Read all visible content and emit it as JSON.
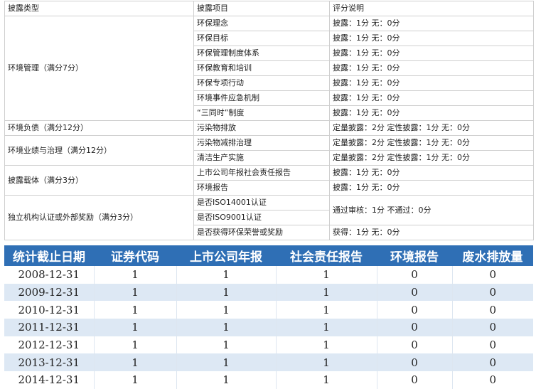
{
  "disclosure_table": {
    "headers": [
      "披露类型",
      "披露项目",
      "评分说明"
    ],
    "groups": [
      {
        "type": "环境管理（满分7分）",
        "items": [
          {
            "item": "环保理念",
            "rule": "披露：1分 无：0分"
          },
          {
            "item": "环保目标",
            "rule": "披露：1分 无：0分"
          },
          {
            "item": "环保管理制度体系",
            "rule": "披露：1分 无：0分"
          },
          {
            "item": "环保教育和培训",
            "rule": "披露：1分 无：0分"
          },
          {
            "item": "环保专项行动",
            "rule": "披露：1分 无：0分"
          },
          {
            "item": "环境事件应急机制",
            "rule": "披露：1分 无：0分"
          },
          {
            "item": "“三同时”制度",
            "rule": "披露：1分 无：0分"
          }
        ]
      },
      {
        "type": "环境负债（满分12分）",
        "items": [
          {
            "item": "污染物排放",
            "rule": "定量披露：2分 定性披露：1分 无：0分"
          }
        ]
      },
      {
        "type": "环境业绩与治理（满分12分）",
        "items": [
          {
            "item": "污染物减排治理",
            "rule": "定量披露：2分 定性披露：1分 无：0分"
          },
          {
            "item": "清洁生产实施",
            "rule": "定量披露：2分 定性披露：1分 无：0分"
          }
        ]
      },
      {
        "type": "披露载体（满分3分）",
        "items": [
          {
            "item": "上市公司年报社会责任报告",
            "rule": "披露：1分 无：0分"
          },
          {
            "item": "环境报告",
            "rule": "披露：1分 无：0分"
          }
        ]
      },
      {
        "type": "独立机构认证或外部奖励（满分3分）",
        "items": [
          {
            "item": "是否ISO14001认证"
          },
          {
            "item": "是否ISO9001认证"
          },
          {
            "item": "是否获得环保荣誉或奖励",
            "rule": "获得：1分 无：0分"
          }
        ],
        "merged_rule": "通过审核：1分 不通过：0分"
      }
    ]
  },
  "data_table": {
    "headers": [
      "统计截止日期",
      "证券代码",
      "上市公司年报",
      "社会责任报告",
      "环境报告",
      "废水排放量"
    ],
    "rows": [
      [
        "2008-12-31",
        "1",
        "1",
        "1",
        "0",
        "0"
      ],
      [
        "2009-12-31",
        "1",
        "1",
        "1",
        "0",
        "0"
      ],
      [
        "2010-12-31",
        "1",
        "1",
        "1",
        "0",
        "0"
      ],
      [
        "2011-12-31",
        "1",
        "1",
        "1",
        "0",
        "0"
      ],
      [
        "2012-12-31",
        "1",
        "1",
        "1",
        "0",
        "0"
      ],
      [
        "2013-12-31",
        "1",
        "1",
        "1",
        "0",
        "0"
      ],
      [
        "2014-12-31",
        "1",
        "1",
        "1",
        "0",
        "0"
      ]
    ]
  }
}
